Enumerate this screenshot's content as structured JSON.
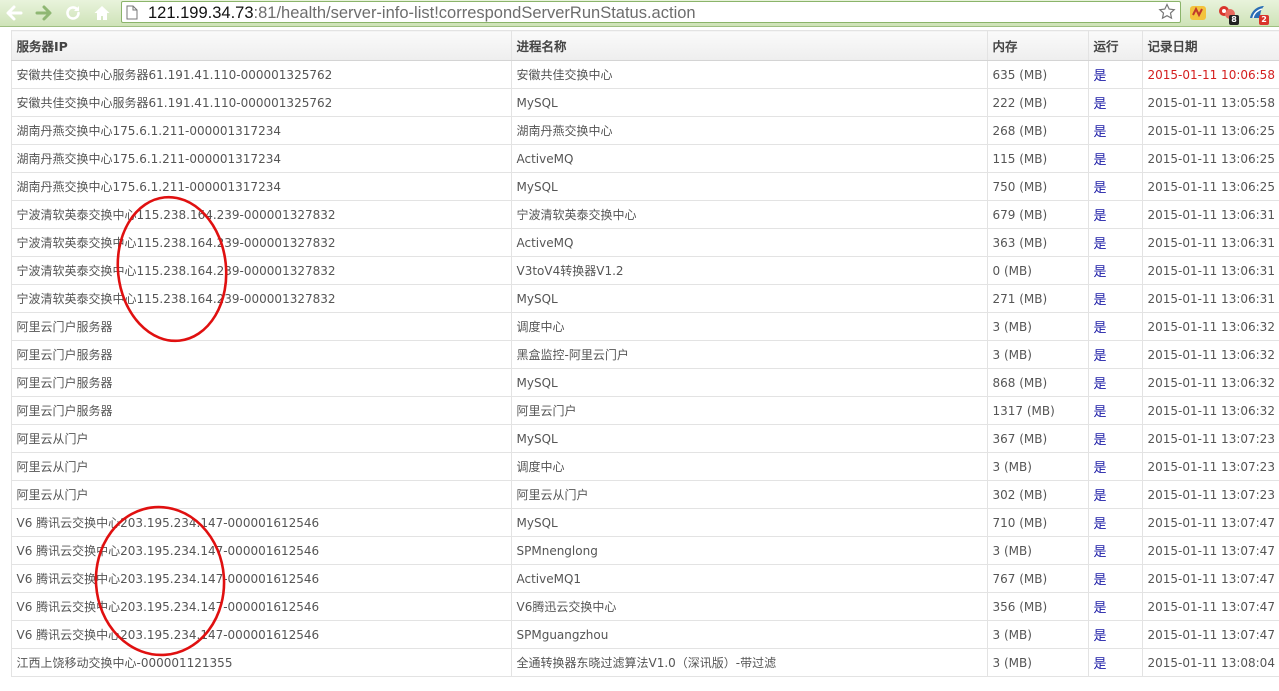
{
  "browser": {
    "url_host": "121.199.34.73",
    "url_path": ":81/health/server-info-list!correspondServerRunStatus.action",
    "extensions": [
      {
        "icon": "extension-icon",
        "badge": ""
      },
      {
        "icon": "extension-icon",
        "badge": "8"
      },
      {
        "icon": "extension-icon",
        "badge": "2"
      }
    ]
  },
  "table": {
    "headers": [
      "服务器IP",
      "进程名称",
      "内存",
      "运行",
      "记录日期"
    ],
    "rows": [
      {
        "ip": "安徽共佳交换中心服务器61.191.41.110-000001325762",
        "process": "安徽共佳交换中心",
        "memory": "635 (MB)",
        "running": "是",
        "date": "2015-01-11 10:06:58",
        "highlight": true
      },
      {
        "ip": "安徽共佳交换中心服务器61.191.41.110-000001325762",
        "process": "MySQL",
        "memory": "222 (MB)",
        "running": "是",
        "date": "2015-01-11 13:05:58"
      },
      {
        "ip": "湖南丹燕交换中心175.6.1.211-000001317234",
        "process": "湖南丹燕交换中心",
        "memory": "268 (MB)",
        "running": "是",
        "date": "2015-01-11 13:06:25"
      },
      {
        "ip": "湖南丹燕交换中心175.6.1.211-000001317234",
        "process": "ActiveMQ",
        "memory": "115 (MB)",
        "running": "是",
        "date": "2015-01-11 13:06:25"
      },
      {
        "ip": "湖南丹燕交换中心175.6.1.211-000001317234",
        "process": "MySQL",
        "memory": "750 (MB)",
        "running": "是",
        "date": "2015-01-11 13:06:25"
      },
      {
        "ip": "宁波清软英泰交换中心115.238.164.239-000001327832",
        "process": "宁波清软英泰交换中心",
        "memory": "679 (MB)",
        "running": "是",
        "date": "2015-01-11 13:06:31"
      },
      {
        "ip": "宁波清软英泰交换中心115.238.164.239-000001327832",
        "process": "ActiveMQ",
        "memory": "363 (MB)",
        "running": "是",
        "date": "2015-01-11 13:06:31"
      },
      {
        "ip": "宁波清软英泰交换中心115.238.164.239-000001327832",
        "process": "V3toV4转换器V1.2",
        "memory": "0 (MB)",
        "running": "是",
        "date": "2015-01-11 13:06:31"
      },
      {
        "ip": "宁波清软英泰交换中心115.238.164.239-000001327832",
        "process": "MySQL",
        "memory": "271 (MB)",
        "running": "是",
        "date": "2015-01-11 13:06:31"
      },
      {
        "ip": "阿里云门户服务器",
        "process": "调度中心",
        "memory": "3 (MB)",
        "running": "是",
        "date": "2015-01-11 13:06:32"
      },
      {
        "ip": "阿里云门户服务器",
        "process": "黑盒监控-阿里云门户",
        "memory": "3 (MB)",
        "running": "是",
        "date": "2015-01-11 13:06:32"
      },
      {
        "ip": "阿里云门户服务器",
        "process": "MySQL",
        "memory": "868 (MB)",
        "running": "是",
        "date": "2015-01-11 13:06:32"
      },
      {
        "ip": "阿里云门户服务器",
        "process": "阿里云门户",
        "memory": "1317 (MB)",
        "running": "是",
        "date": "2015-01-11 13:06:32"
      },
      {
        "ip": "阿里云从门户",
        "process": "MySQL",
        "memory": "367 (MB)",
        "running": "是",
        "date": "2015-01-11 13:07:23"
      },
      {
        "ip": "阿里云从门户",
        "process": "调度中心",
        "memory": "3 (MB)",
        "running": "是",
        "date": "2015-01-11 13:07:23"
      },
      {
        "ip": "阿里云从门户",
        "process": "阿里云从门户",
        "memory": "302 (MB)",
        "running": "是",
        "date": "2015-01-11 13:07:23"
      },
      {
        "ip": "V6 腾讯云交换中心203.195.234.147-000001612546",
        "process": "MySQL",
        "memory": "710 (MB)",
        "running": "是",
        "date": "2015-01-11 13:07:47"
      },
      {
        "ip": "V6 腾讯云交换中心203.195.234.147-000001612546",
        "process": "SPMnenglong",
        "memory": "3 (MB)",
        "running": "是",
        "date": "2015-01-11 13:07:47"
      },
      {
        "ip": "V6 腾讯云交换中心203.195.234.147-000001612546",
        "process": "ActiveMQ1",
        "memory": "767 (MB)",
        "running": "是",
        "date": "2015-01-11 13:07:47"
      },
      {
        "ip": "V6 腾讯云交换中心203.195.234.147-000001612546",
        "process": "V6腾迅云交换中心",
        "memory": "356 (MB)",
        "running": "是",
        "date": "2015-01-11 13:07:47"
      },
      {
        "ip": "V6 腾讯云交换中心203.195.234.147-000001612546",
        "process": "SPMguangzhou",
        "memory": "3 (MB)",
        "running": "是",
        "date": "2015-01-11 13:07:47"
      },
      {
        "ip": "江西上饶移动交换中心-000001121355",
        "process": "全通转换器东晓过滤算法V1.0（深讯版）-带过滤",
        "memory": "3 (MB)",
        "running": "是",
        "date": "2015-01-11 13:08:04"
      }
    ]
  },
  "colors": {
    "running_text": "#1a1aa6",
    "highlight_date": "#d42020",
    "annotation": "#e01010",
    "toolbar_green": "#cfe3b8"
  }
}
